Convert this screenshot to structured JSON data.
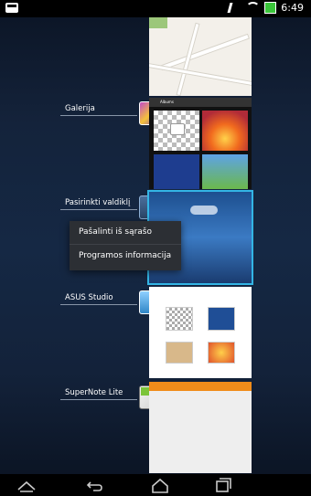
{
  "status_bar": {
    "time": "6:49",
    "icons": [
      "mute-icon",
      "wifi-icon",
      "battery-icon"
    ]
  },
  "recent_apps": [
    {
      "label": "Galerija",
      "icon": "gallery-icon"
    },
    {
      "label": "Pasirinkti valdiklį",
      "icon": "widget-picker-icon"
    },
    {
      "label": "ASUS Studio",
      "icon": "asus-studio-icon"
    },
    {
      "label": "SuperNote Lite",
      "icon": "supernote-icon"
    }
  ],
  "context_menu": {
    "items": [
      "Pašalinti iš sąrašo",
      "Programos informacija"
    ]
  },
  "gallery_thumb": {
    "header": "Albums"
  },
  "nav_bar": {
    "icons": [
      "back-icon",
      "home-icon",
      "recents-icon",
      "menu-up-icon"
    ]
  },
  "colors": {
    "accent": "#33b5e5",
    "background": "#13223a",
    "supernote_bar": "#f08c1a"
  }
}
